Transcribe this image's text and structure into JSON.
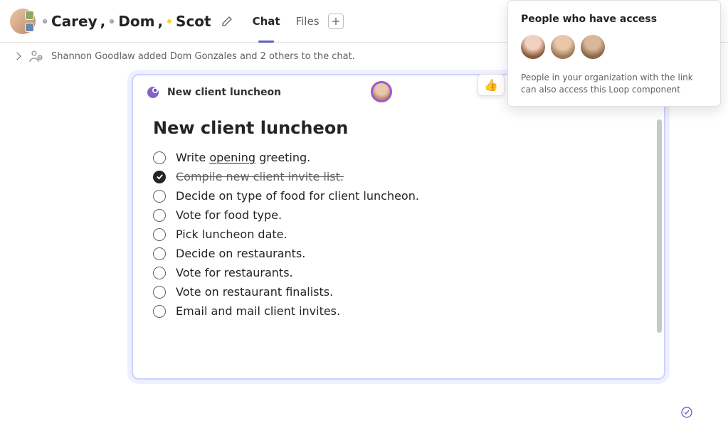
{
  "header": {
    "participants": [
      {
        "name": "Carey",
        "presence": "offline"
      },
      {
        "name": "Dom",
        "presence": "offline"
      },
      {
        "name": "Scot",
        "presence": "away"
      }
    ],
    "tabs": [
      {
        "id": "chat",
        "label": "Chat",
        "active": true
      },
      {
        "id": "files",
        "label": "Files",
        "active": false
      }
    ]
  },
  "system_message": "Shannon Goodlaw added Dom Gonzales and 2 others to the chat.",
  "loop_card": {
    "tab_name": "New client luncheon",
    "title": "New client luncheon",
    "tasks": [
      {
        "text_pre": "Write ",
        "err": "opening",
        "text_post": " greeting.",
        "done": false,
        "has_err": true
      },
      {
        "text": "Compile new client invite list.",
        "done": true
      },
      {
        "text": "Decide on type of food for client luncheon.",
        "done": false
      },
      {
        "text": "Vote for food type.",
        "done": false
      },
      {
        "text": "Pick luncheon date.",
        "done": false
      },
      {
        "text": "Decide on restaurants.",
        "done": false
      },
      {
        "text": "Vote for restaurants.",
        "done": false
      },
      {
        "text": "Vote on restaurant finalists.",
        "done": false
      },
      {
        "text": "Email and mail client invites.",
        "done": false
      }
    ]
  },
  "reaction_emoji": "👍",
  "popover": {
    "title": "People who have access",
    "description": "People in your organization with the link can also access this Loop component"
  }
}
